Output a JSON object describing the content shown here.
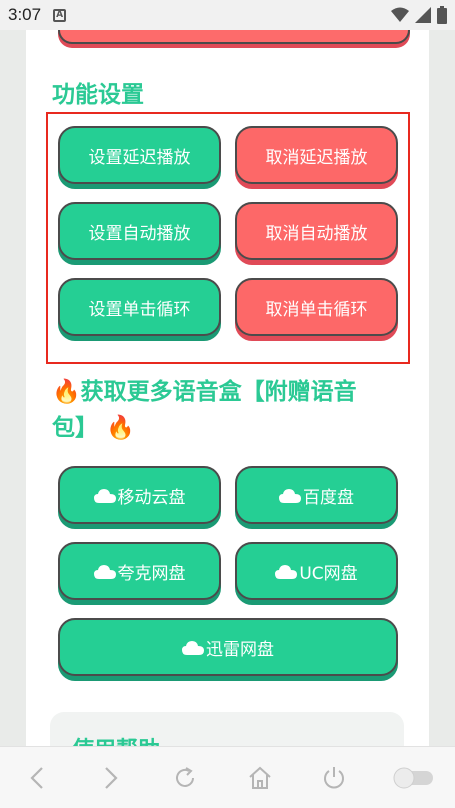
{
  "status_bar": {
    "time": "3:07",
    "a_icon": "A"
  },
  "section_title": "功能设置",
  "settings_buttons": [
    {
      "label": "设置延迟播放",
      "color": "green"
    },
    {
      "label": "取消延迟播放",
      "color": "red"
    },
    {
      "label": "设置自动播放",
      "color": "green"
    },
    {
      "label": "取消自动播放",
      "color": "red"
    },
    {
      "label": "设置单击循环",
      "color": "green"
    },
    {
      "label": "取消单击循环",
      "color": "red"
    }
  ],
  "more_title": {
    "fire_left": "🔥",
    "text": "获取更多语音盒【附赠语音包】",
    "fire_right": "🔥"
  },
  "cloud_buttons": [
    {
      "label": "移动云盘",
      "icon": "cloud-icon"
    },
    {
      "label": "百度盘",
      "icon": "cloud-icon"
    },
    {
      "label": "夸克网盘",
      "icon": "cloud-icon"
    },
    {
      "label": "UC网盘",
      "icon": "cloud-icon"
    },
    {
      "label": "迅雷网盘",
      "icon": "cloud-icon"
    }
  ],
  "help_title": "使用帮助",
  "colors": {
    "accent_green": "#25cf94",
    "accent_red": "#fd6868",
    "title_green": "#2bc994",
    "frame_red": "#e8291f"
  },
  "bottom_nav": [
    "back-icon",
    "forward-icon",
    "refresh-icon",
    "home-icon",
    "power-icon",
    "toggle-switch"
  ]
}
